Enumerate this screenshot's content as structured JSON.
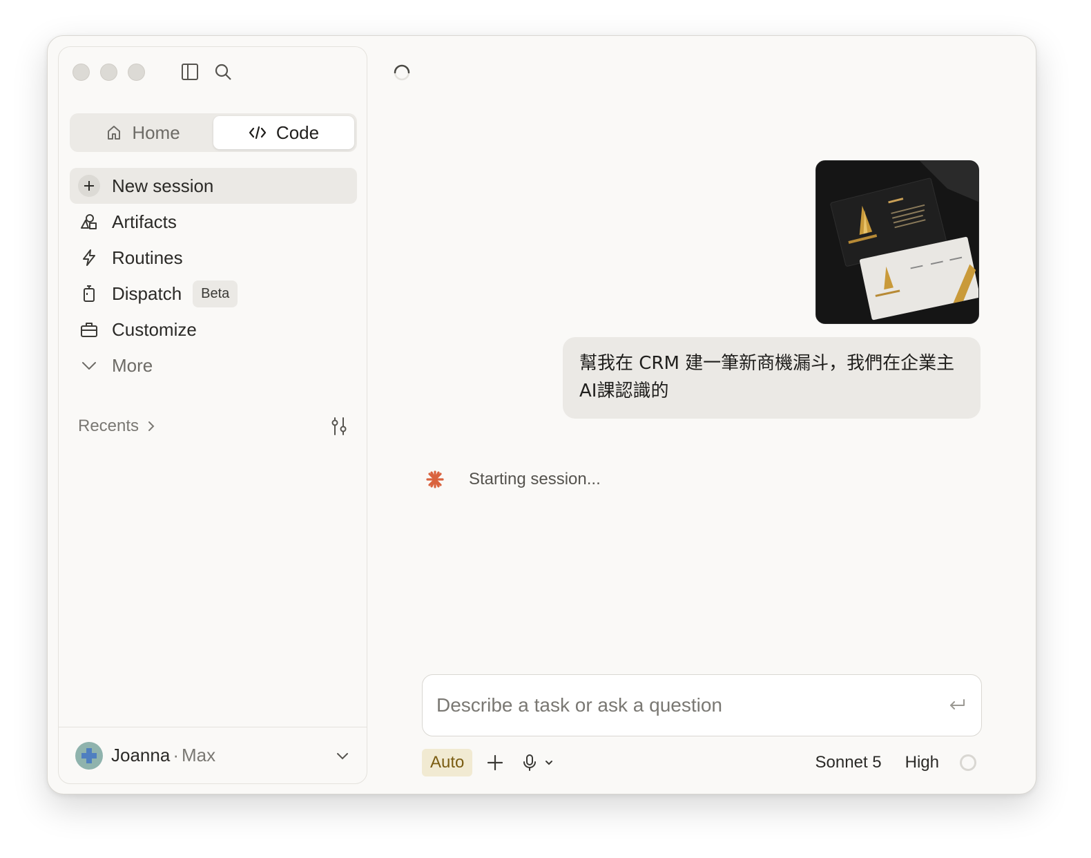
{
  "sidebar": {
    "tabs": [
      {
        "label": "Home",
        "icon": "home-icon",
        "active": false
      },
      {
        "label": "Code",
        "icon": "code-icon",
        "active": true
      }
    ],
    "nav": [
      {
        "label": "New session",
        "icon": "plus-icon"
      },
      {
        "label": "Artifacts",
        "icon": "artifacts-icon"
      },
      {
        "label": "Routines",
        "icon": "lightning-icon"
      },
      {
        "label": "Dispatch",
        "icon": "dispatch-icon",
        "badge": "Beta"
      },
      {
        "label": "Customize",
        "icon": "briefcase-icon"
      },
      {
        "label": "More",
        "icon": "chevron-down-icon"
      }
    ],
    "recents_label": "Recents",
    "user": {
      "name": "Joanna",
      "separator": "·",
      "plan": "Max"
    }
  },
  "chat": {
    "attachment_icon": "image-attachment",
    "user_message": "幫我在 CRM 建一筆新商機漏斗，我們在企業主AI課認識的",
    "status": "Starting session..."
  },
  "composer": {
    "placeholder": "Describe a task or ask a question",
    "mode": "Auto",
    "model": "Sonnet 5",
    "effort": "High"
  },
  "colors": {
    "accent": "#d9633f",
    "auto_pill_bg": "#f1ead2",
    "auto_pill_text": "#7a5c12"
  }
}
